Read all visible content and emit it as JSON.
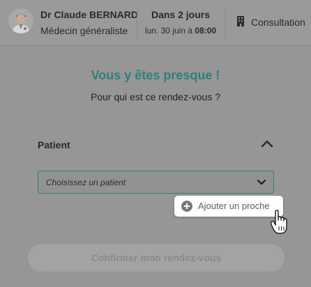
{
  "header": {
    "doctor_name": "Dr Claude BERNARD",
    "specialty": "Médecin généraliste",
    "when_main": "Dans 2 jours",
    "when_date": "lun. 30 juin à ",
    "when_time": "08:00",
    "motif": "Consultation",
    "building_icon": "building-icon"
  },
  "main": {
    "title": "Vous y êtes presque !",
    "question": "Pour qui est ce rendez-vous ?",
    "section_label": "Patient",
    "select_placeholder": "Choisissez un patient",
    "add_proche_label": "Ajouter un proche",
    "confirm_label": "Confirmer mon rendez-vous"
  },
  "colors": {
    "accent": "#2f7f7a",
    "overlay": "#969696"
  }
}
